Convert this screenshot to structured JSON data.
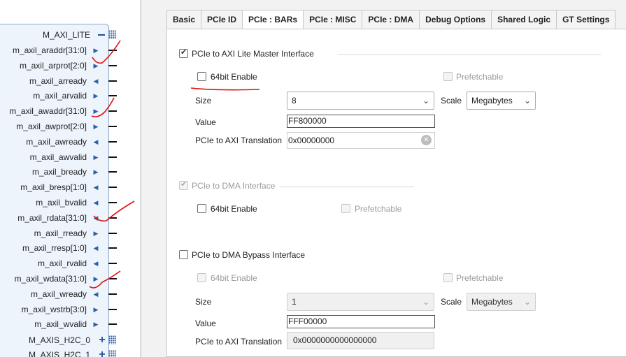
{
  "tabs": [
    {
      "label": "Basic"
    },
    {
      "label": "PCIe ID"
    },
    {
      "label": "PCIe : BARs",
      "active": true
    },
    {
      "label": "PCIe : MISC"
    },
    {
      "label": "PCIe : DMA"
    },
    {
      "label": "Debug Options"
    },
    {
      "label": "Shared Logic"
    },
    {
      "label": "GT Settings"
    }
  ],
  "block": {
    "bus_label": "M_AXI_LITE",
    "ports": [
      {
        "name": "m_axil_araddr[31:0]",
        "dir": "out"
      },
      {
        "name": "m_axil_arprot[2:0]",
        "dir": "out"
      },
      {
        "name": "m_axil_arready",
        "dir": "in"
      },
      {
        "name": "m_axil_arvalid",
        "dir": "out"
      },
      {
        "name": "m_axil_awaddr[31:0]",
        "dir": "out"
      },
      {
        "name": "m_axil_awprot[2:0]",
        "dir": "out"
      },
      {
        "name": "m_axil_awready",
        "dir": "in"
      },
      {
        "name": "m_axil_awvalid",
        "dir": "out"
      },
      {
        "name": "m_axil_bready",
        "dir": "out"
      },
      {
        "name": "m_axil_bresp[1:0]",
        "dir": "in"
      },
      {
        "name": "m_axil_bvalid",
        "dir": "in"
      },
      {
        "name": "m_axil_rdata[31:0]",
        "dir": "in"
      },
      {
        "name": "m_axil_rready",
        "dir": "out"
      },
      {
        "name": "m_axil_rresp[1:0]",
        "dir": "in"
      },
      {
        "name": "m_axil_rvalid",
        "dir": "in"
      },
      {
        "name": "m_axil_wdata[31:0]",
        "dir": "out"
      },
      {
        "name": "m_axil_wready",
        "dir": "in"
      },
      {
        "name": "m_axil_wstrb[3:0]",
        "dir": "out"
      },
      {
        "name": "m_axil_wvalid",
        "dir": "out"
      }
    ],
    "extra_buses": [
      "M_AXIS_H2C_0",
      "M_AXIS_H2C_1"
    ],
    "icons": {
      "out": "right-arrow-icon",
      "in": "left-arrow-icon",
      "bus_expand": "plus-icon"
    }
  },
  "axi_lite": {
    "enable_label": "PCIe to AXI Lite Master Interface",
    "enable_checked": true,
    "bit64_label": "64bit Enable",
    "bit64_checked": false,
    "prefetch_label": "Prefetchable",
    "prefetch_checked": false,
    "size_label": "Size",
    "size_value": "8",
    "scale_label": "Scale",
    "scale_value": "Megabytes",
    "value_label": "Value",
    "value_value": "FF800000",
    "translation_label": "PCIe to AXI Translation",
    "translation_value": "0x00000000"
  },
  "dma": {
    "enable_label": "PCIe to DMA Interface",
    "enable_checked": true,
    "bit64_label": "64bit Enable",
    "bit64_checked": false,
    "prefetch_label": "Prefetchable",
    "prefetch_checked": false
  },
  "dma_bypass": {
    "enable_label": "PCIe to DMA Bypass Interface",
    "enable_checked": false,
    "bit64_label": "64bit Enable",
    "prefetch_label": "Prefetchable",
    "size_label": "Size",
    "size_value": "1",
    "scale_label": "Scale",
    "scale_value": "Megabytes",
    "value_label": "Value",
    "value_value": "FFF00000",
    "translation_label": "PCIe to AXI Translation",
    "translation_value": "0x0000000000000000"
  },
  "colors": {
    "block_fill": "#edf4fc",
    "block_border": "#8ea9c9",
    "port_arrow": "#2b5fa8",
    "annotation": "#e01010"
  }
}
